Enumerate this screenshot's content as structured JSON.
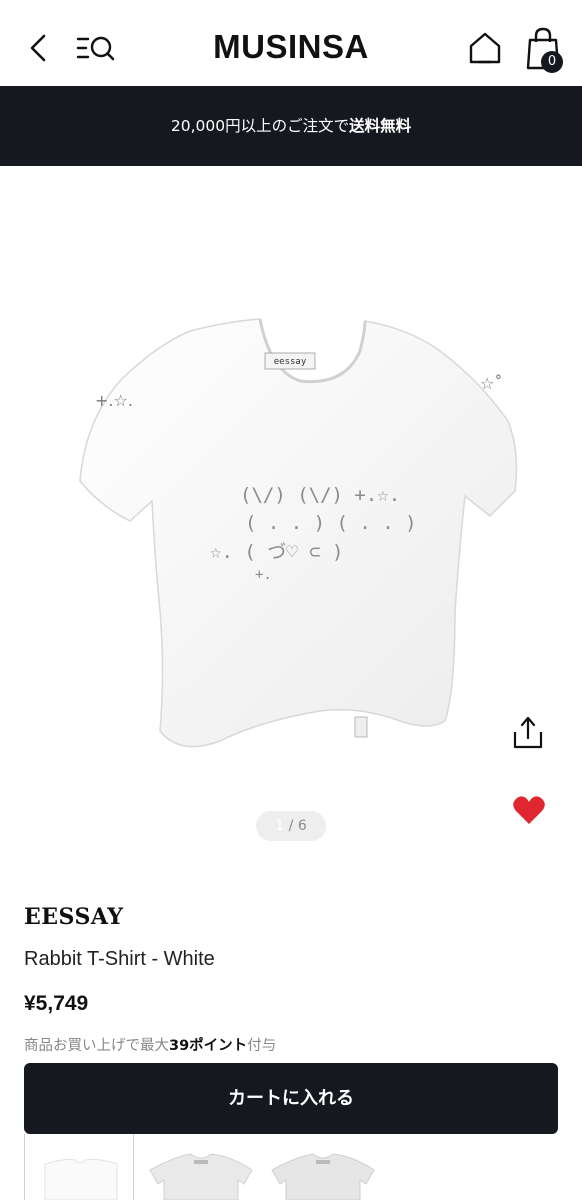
{
  "header": {
    "logo": "MUSINSA",
    "cart_count": "0"
  },
  "banner": {
    "text_prefix": "20,000円以上のご注文で",
    "text_bold": "送料無料"
  },
  "gallery": {
    "page_current": "1",
    "page_separator": "/",
    "page_total": "6",
    "print_text": "(\\/) (\\/)\n( . . ) ( . . )\n( づ♡ ⊂ )"
  },
  "product": {
    "brand": "EESSAY",
    "name": "Rabbit T-Shirt - White",
    "price": "¥5,749",
    "points_prefix": "商品お買い上げで最大",
    "points_value": "39ポイント",
    "points_suffix": "付与"
  },
  "actions": {
    "add_to_cart": "カートに入れる"
  },
  "colors": {
    "dark": "#16181f",
    "heart": "#e0262e"
  },
  "icons": [
    "back-icon",
    "search-menu-icon",
    "home-icon",
    "shopping-bag-icon",
    "share-icon",
    "heart-icon"
  ]
}
